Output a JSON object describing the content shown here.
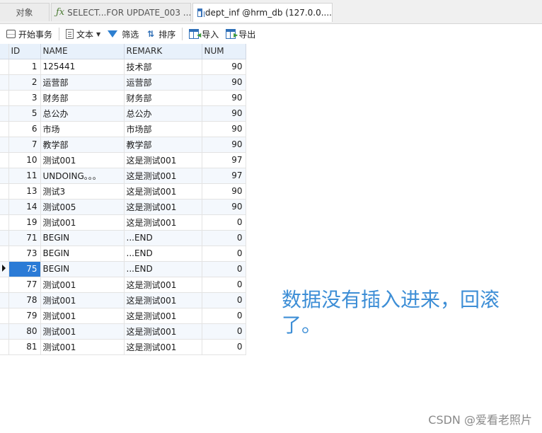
{
  "tabs": [
    {
      "label": "对象"
    },
    {
      "label": "SELECT...FOR UPDATE_003 ..."
    },
    {
      "label": "dept_inf @hrm_db (127.0.0...."
    }
  ],
  "toolbar": {
    "begin_transaction": "开始事务",
    "text": "文本",
    "filter": "筛选",
    "sort": "排序",
    "import": "导入",
    "export": "导出"
  },
  "grid": {
    "columns": [
      "ID",
      "NAME",
      "REMARK",
      "NUM"
    ],
    "selected_row_index": 13,
    "rows": [
      {
        "id": "1",
        "name": "125441",
        "remark": "技术部",
        "num": "90"
      },
      {
        "id": "2",
        "name": "运营部",
        "remark": "运营部",
        "num": "90"
      },
      {
        "id": "3",
        "name": "财务部",
        "remark": "财务部",
        "num": "90"
      },
      {
        "id": "5",
        "name": "总公办",
        "remark": "总公办",
        "num": "90"
      },
      {
        "id": "6",
        "name": "市场",
        "remark": "市场部",
        "num": "90"
      },
      {
        "id": "7",
        "name": "教学部",
        "remark": "教学部",
        "num": "90"
      },
      {
        "id": "10",
        "name": "测试001",
        "remark": "这是测试001",
        "num": "97"
      },
      {
        "id": "11",
        "name": "UNDOING。。。",
        "remark": "这是测试001",
        "num": "97"
      },
      {
        "id": "13",
        "name": "测试3",
        "remark": "这是测试001",
        "num": "90"
      },
      {
        "id": "14",
        "name": "测试005",
        "remark": "这是测试001",
        "num": "90"
      },
      {
        "id": "19",
        "name": "测试001",
        "remark": "这是测试001",
        "num": "0"
      },
      {
        "id": "71",
        "name": "BEGIN",
        "remark": "...END",
        "num": "0"
      },
      {
        "id": "73",
        "name": "BEGIN",
        "remark": "...END",
        "num": "0"
      },
      {
        "id": "75",
        "name": "BEGIN",
        "remark": "...END",
        "num": "0"
      },
      {
        "id": "77",
        "name": "测试001",
        "remark": "这是测试001",
        "num": "0"
      },
      {
        "id": "78",
        "name": "测试001",
        "remark": "这是测试001",
        "num": "0"
      },
      {
        "id": "79",
        "name": "测试001",
        "remark": "这是测试001",
        "num": "0"
      },
      {
        "id": "80",
        "name": "测试001",
        "remark": "这是测试001",
        "num": "0"
      },
      {
        "id": "81",
        "name": "测试001",
        "remark": "这是测试001",
        "num": "0"
      }
    ]
  },
  "annotation": {
    "text": "数据没有插入进来，回滚了。"
  },
  "watermark": "CSDN @爱看老照片"
}
